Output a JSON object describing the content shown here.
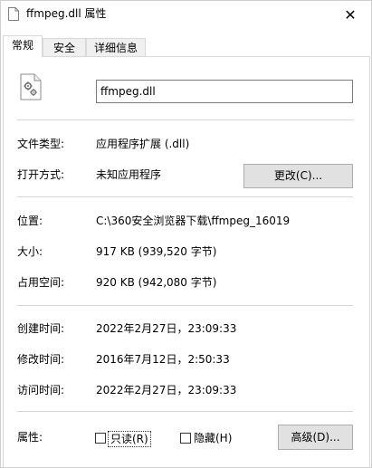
{
  "window": {
    "title": "ffmpeg.dll 属性",
    "close_glyph": "✕"
  },
  "tabs": [
    {
      "label": "常规"
    },
    {
      "label": "安全"
    },
    {
      "label": "详细信息"
    }
  ],
  "general": {
    "file_name": "ffmpeg.dll",
    "file_type_label": "文件类型:",
    "file_type_value": "应用程序扩展 (.dll)",
    "opens_with_label": "打开方式:",
    "opens_with_value": "未知应用程序",
    "change_button": "更改(C)...",
    "location_label": "位置:",
    "location_value": "C:\\360安全浏览器下载\\ffmpeg_16019",
    "size_label": "大小:",
    "size_value": "917 KB (939,520 字节)",
    "size_on_disk_label": "占用空间:",
    "size_on_disk_value": "920 KB (942,080 字节)",
    "created_label": "创建时间:",
    "created_value": "2022年2月27日，23:09:33",
    "modified_label": "修改时间:",
    "modified_value": "2016年7月12日，2:50:33",
    "accessed_label": "访问时间:",
    "accessed_value": "2022年2月27日，23:09:33",
    "attributes_label": "属性:",
    "readonly_label": "只读(R)",
    "readonly_checked": false,
    "hidden_label": "隐藏(H)",
    "hidden_checked": false,
    "advanced_button": "高级(D)..."
  },
  "icons": {
    "title_icon": "file-icon",
    "file_icon": "dll-file-gear-icon"
  }
}
